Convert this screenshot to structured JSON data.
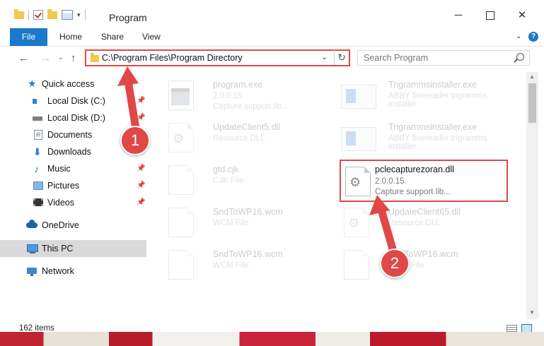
{
  "window": {
    "title": "Program",
    "minimize": "─",
    "close": "✕"
  },
  "ribbon": {
    "tabs": [
      "File",
      "Home",
      "Share",
      "View"
    ],
    "collapse_caret": "⌄",
    "help": "?"
  },
  "address": {
    "path": "C:\\Program Files\\Program Directory",
    "dropdown_glyph": "⌄",
    "refresh_glyph": "↻"
  },
  "nav_buttons": {
    "back": "←",
    "forward": "→",
    "recent": "⌄",
    "up": "↑"
  },
  "search": {
    "placeholder": "Search Program"
  },
  "nav_pane": {
    "pin_glyph": "📌",
    "items": [
      {
        "label": "Quick access",
        "icon": "star-icon",
        "pinned": false
      },
      {
        "label": "Local Disk (C:)",
        "icon": "local-disk-icon",
        "pinned": true
      },
      {
        "label": "Local Disk (D:)",
        "icon": "disk-drive-icon",
        "pinned": true
      },
      {
        "label": "Documents",
        "icon": "documents-icon",
        "pinned": false
      },
      {
        "label": "Downloads",
        "icon": "download-arrow-icon",
        "pinned": true
      },
      {
        "label": "Music",
        "icon": "music-note-icon",
        "pinned": true
      },
      {
        "label": "Pictures",
        "icon": "pictures-icon",
        "pinned": true
      },
      {
        "label": "Videos",
        "icon": "film-strip-icon",
        "pinned": true
      },
      {
        "label": "OneDrive",
        "icon": "cloud-icon",
        "pinned": false
      },
      {
        "label": "This PC",
        "icon": "computer-icon",
        "pinned": false,
        "selected": true
      },
      {
        "label": "Network",
        "icon": "network-icon",
        "pinned": false
      }
    ]
  },
  "files": [
    {
      "name": "program.exe",
      "line1": "2.0.0.15",
      "line2": "Capture support lib...",
      "icon": "exe-icon"
    },
    {
      "name": "Trigrammsinstaller.exe",
      "line1": "ABBY finereader trigramms installer",
      "line2": "",
      "icon": "installer-icon"
    },
    {
      "name": "UpdateClient5.dll",
      "line1": "Resource DLL",
      "line2": "",
      "icon": "dll-gear-icon"
    },
    {
      "name": "Trigrammsinstaller.exe",
      "line1": "ABBY finereader trigramms installer",
      "line2": "",
      "icon": "installer-icon"
    },
    {
      "name": "gtd.cjk",
      "line1": "CJK File",
      "line2": "",
      "icon": "file-icon"
    },
    {
      "name": "pclecapturezoran.dll",
      "line1": "2.0.0.15",
      "line2": "Capture support lib...",
      "icon": "dll-gear-icon",
      "highlighted": true
    },
    {
      "name": "SndToWP16.wcm",
      "line1": "WCM File",
      "line2": "",
      "icon": "file-icon"
    },
    {
      "name": "UpdateClient65.dll",
      "line1": "Resource DLL",
      "line2": "",
      "icon": "dll-gear-icon"
    },
    {
      "name": "SndToWP16.wcm",
      "line1": "WCM File",
      "line2": "",
      "icon": "file-icon"
    },
    {
      "name": "SndToWP16.wcm",
      "line1": "WCM File",
      "line2": "",
      "icon": "file-icon"
    }
  ],
  "status": {
    "item_count": "162 items"
  },
  "annotations": {
    "step1": "1",
    "step2": "2",
    "accent": "#e04848"
  },
  "colors": {
    "file_tab": "#1979ca",
    "highlight_border": "#e04848",
    "selected_nav": "#d9d9d9"
  }
}
